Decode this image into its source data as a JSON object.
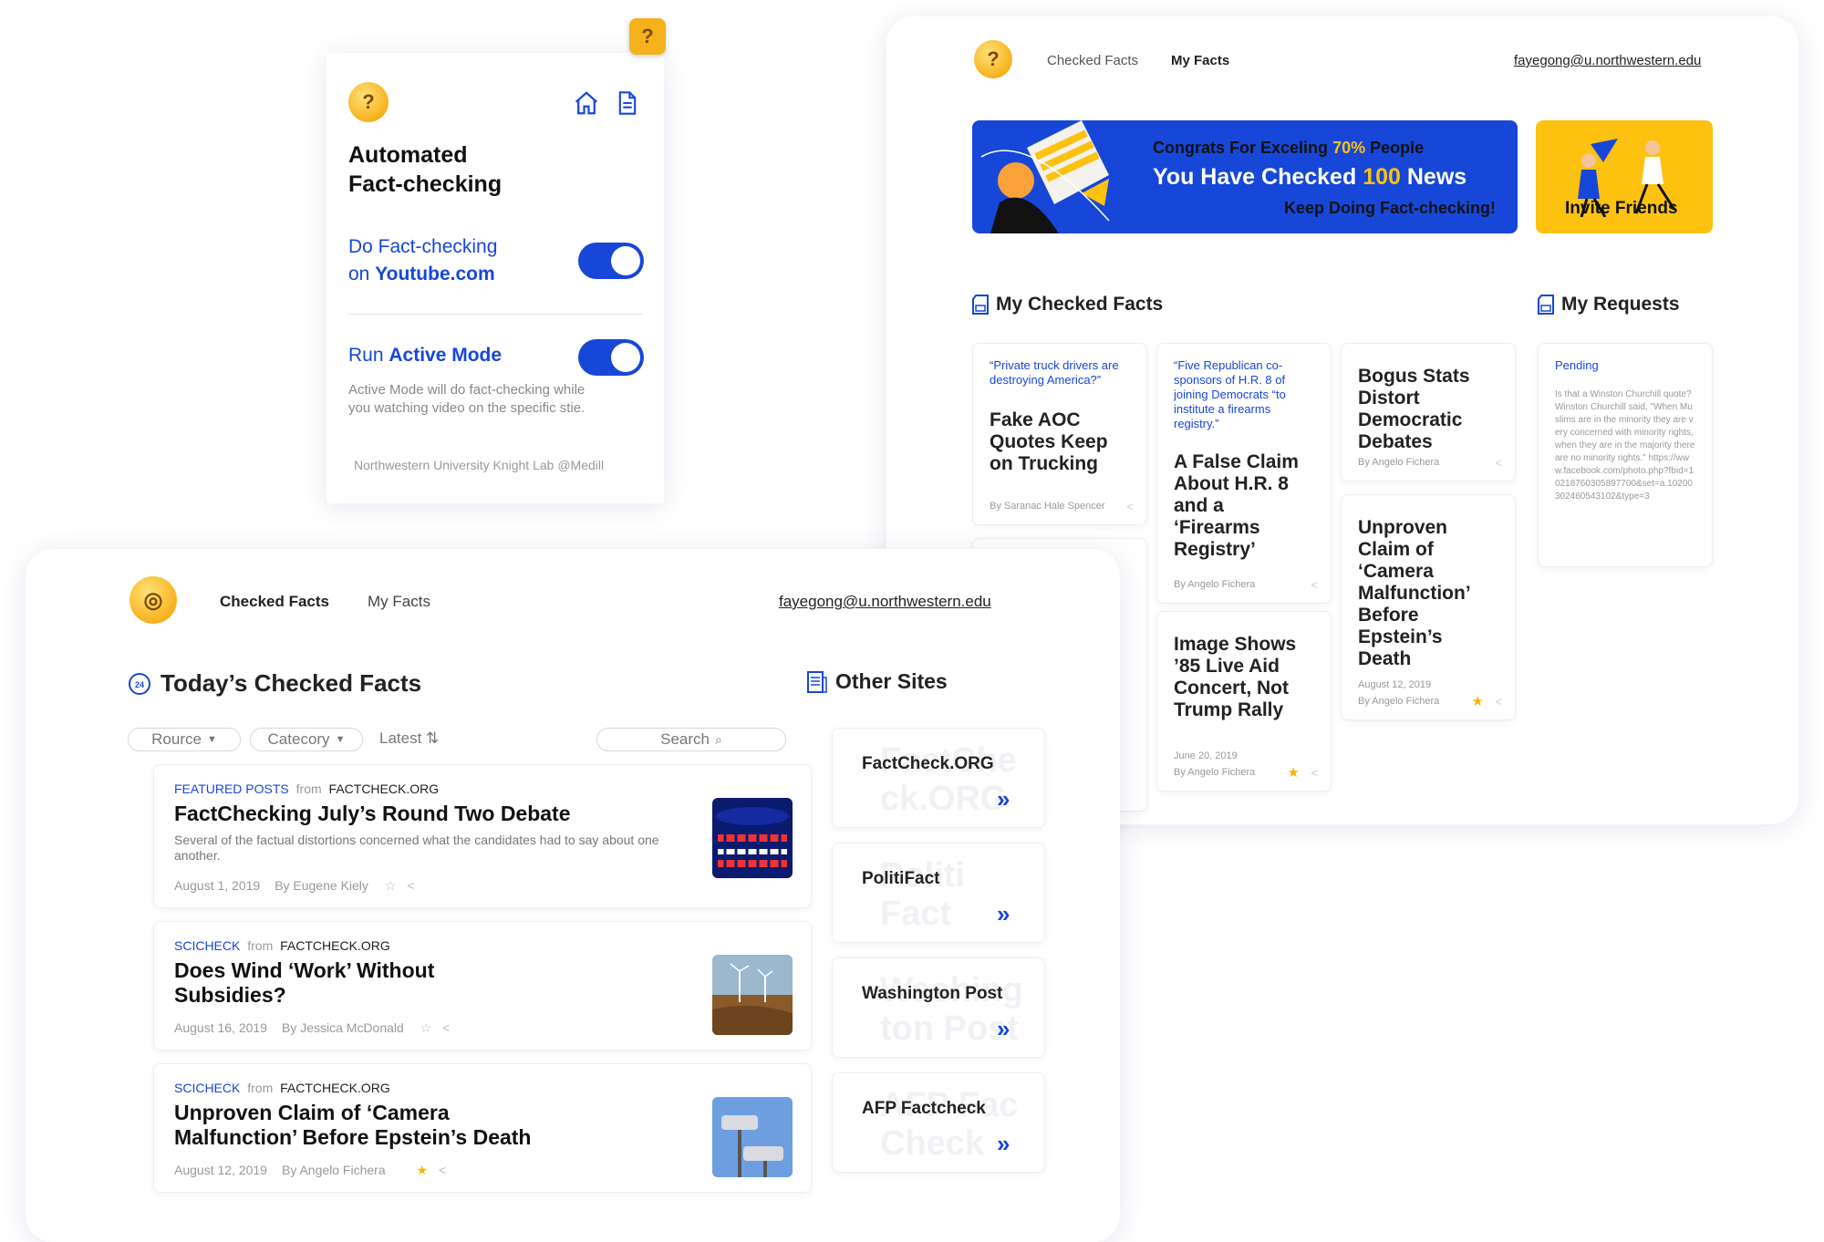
{
  "popup": {
    "title_line1": "Automated",
    "title_line2": "Fact-checking",
    "do_prefix": "Do Fact-checking",
    "on_word": "on",
    "site": "Youtube.com",
    "run_prefix": "Run",
    "active_mode": "Active Mode",
    "active_desc_line1": "Active Mode will do fact-checking while",
    "active_desc_line2": "you watching video on the specific stie.",
    "footer": "Northwestern University Knight Lab @Medill"
  },
  "myfacts": {
    "nav": [
      "Checked Facts",
      "My Facts"
    ],
    "email": "fayegong@u.northwestern.edu",
    "banner": {
      "line1_pre": "Congrats For Exceling",
      "line1_pct": "70%",
      "line1_post": "People",
      "line2_pre": "You Have Checked",
      "line2_num": "100",
      "line2_post": "News",
      "line3": "Keep Doing Fact-checking!",
      "invite": "Invite Friends"
    },
    "section_checked": "My Checked Facts",
    "section_requests": "My Requests",
    "cards": [
      {
        "quote": "“Private truck drivers are destroying America?”",
        "title": "Fake AOC Quotes Keep on Trucking",
        "by": "By Saranac Hale Spencer"
      },
      {
        "quote": "“Five Republican co-sponsors of H.R. 8 of joining Democrats “to institute a firearms registry.”",
        "title": "A False Claim About H.R. 8 and a ‘Firearms Registry’",
        "by": "By Angelo Fichera"
      },
      {
        "title": "Bogus Stats Distort Democratic Debates",
        "by": "By Angelo Fichera"
      },
      {
        "title": "Image Shows ’85 Live Aid Concert, Not Trump Rally",
        "date": "June 20, 2019",
        "by": "By Angelo Fichera"
      },
      {
        "title": "Unproven Claim of ‘Camera Malfunction’ Before Epstein’s Death",
        "date": "August 12, 2019",
        "by": "By Angelo Fichera"
      }
    ],
    "request": {
      "status": "Pending",
      "text": "Is that a Winston Churchill quote? Winston Churchill said, \"When Muslims are in the minority they are very concerned with minority rights, when they are in the majority there are no minority rights.\" https://www.facebook.com/photo.php?fbid=10218760305897700&set=a.10200302460543102&type=3"
    }
  },
  "main": {
    "nav": [
      "Checked Facts",
      "My Facts"
    ],
    "email": "fayegong@u.northwestern.edu",
    "section_today": "Today’s Checked Facts",
    "section_sites": "Other Sites",
    "filters": {
      "source": "Rource",
      "category": "Catecory",
      "latest": "Latest",
      "search_placeholder": "Search"
    },
    "items": [
      {
        "tag": "FEATURED POSTS",
        "from": "from",
        "source": "FACTCHECK.ORG",
        "title": "FactChecking July’s Round Two Debate",
        "desc": "Several of the factual distortions concerned what the candidates had to say about one another.",
        "date": "August 1, 2019",
        "by": "By Eugene Kiely"
      },
      {
        "tag": "SCICHECK",
        "from": "from",
        "source": "FACTCHECK.ORG",
        "title": "Does Wind ‘Work’ Without Subsidies?",
        "date": "August 16, 2019",
        "by": "By Jessica McDonald"
      },
      {
        "tag": "SCICHECK",
        "from": "from",
        "source": "FACTCHECK.ORG",
        "title": "Unproven Claim of ‘Camera Malfunction’ Before Epstein’s Death",
        "date": "August 12, 2019",
        "by": "By Angelo Fichera"
      }
    ],
    "sites": [
      {
        "name": "FactCheck.ORG",
        "bg1": "FactChe",
        "bg2": "ck.ORG"
      },
      {
        "name": "PolitiFact",
        "bg1": "Politi",
        "bg2": "Fact"
      },
      {
        "name": "Washington Post",
        "bg1": "Washing",
        "bg2": "ton Post"
      },
      {
        "name": "AFP Factcheck",
        "bg1": "AFP Fac",
        "bg2": "Check"
      }
    ]
  },
  "colors": {
    "accent": "#1747d8",
    "banner_yellow": "#fdc20f",
    "star": "#f7b500"
  }
}
